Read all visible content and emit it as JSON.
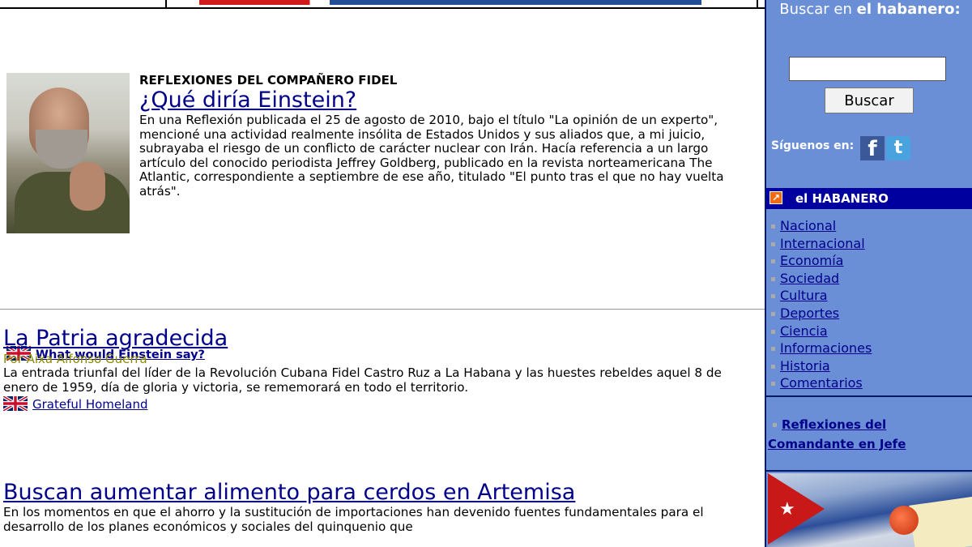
{
  "article1": {
    "kicker": "REFLEXIONES DEL COMPAÑERO FIDEL",
    "title": "¿Qué diría Einstein?",
    "body": "En una Reflexión publicada el 25 de agosto de 2010, bajo el título \"La opinión de un experto\", mencioné una actividad realmente insólita de Estados Unidos y sus aliados que, a mi juicio, subrayaba el riesgo de un conflicto de carácter nuclear con Irán. Hacía referencia a un largo artículo del conocido periodista Jeffrey Goldberg, publicado en la revista norteamericana The Atlantic, correspondiente a septiembre de ese año, titulado \"El punto tras el que no hay vuelta atrás\".",
    "english_link": "What would Einstein say?"
  },
  "article2": {
    "title": "La Patria agradecida",
    "byline": "Por Aixa Alfonso Guerra",
    "body": "La entrada triunfal del líder de la Revolución Cubana Fidel Castro Ruz a La Habana y las huestes rebeldes aquel 8 de enero de 1959, día de gloria y victoria, se rememorará en todo el territorio.",
    "english_link": "Grateful Homeland"
  },
  "article3": {
    "title": "Buscan aumentar alimento para cerdos en Artemisa",
    "body": "En los momentos en que el ahorro y la sustitución de importaciones han devenido fuentes fundamentales para el desarrollo de los planes económicos y sociales del quinquenio que"
  },
  "sidebar": {
    "search_title_prefix": "Buscar en",
    "search_title_brand": "el habanero:",
    "search_value": "",
    "search_button": "Buscar",
    "follow_label": "Síguenos en:",
    "facebook_glyph": "f",
    "twitter_glyph": "t",
    "section_title": "el HABANERO",
    "nav_items": [
      "Nacional",
      "Internacional",
      "Economía",
      "Sociedad",
      "Cultura",
      "Deportes",
      "Ciencia",
      "Informaciones",
      "Historia",
      "Comentarios"
    ],
    "reflexiones_link": "Reflexiones del Comandante en Jefe"
  },
  "colors": {
    "link": "#00008b",
    "sidebar_bg": "#6b8fd6",
    "section_bar": "#00009e",
    "byline": "#8b8b00"
  }
}
